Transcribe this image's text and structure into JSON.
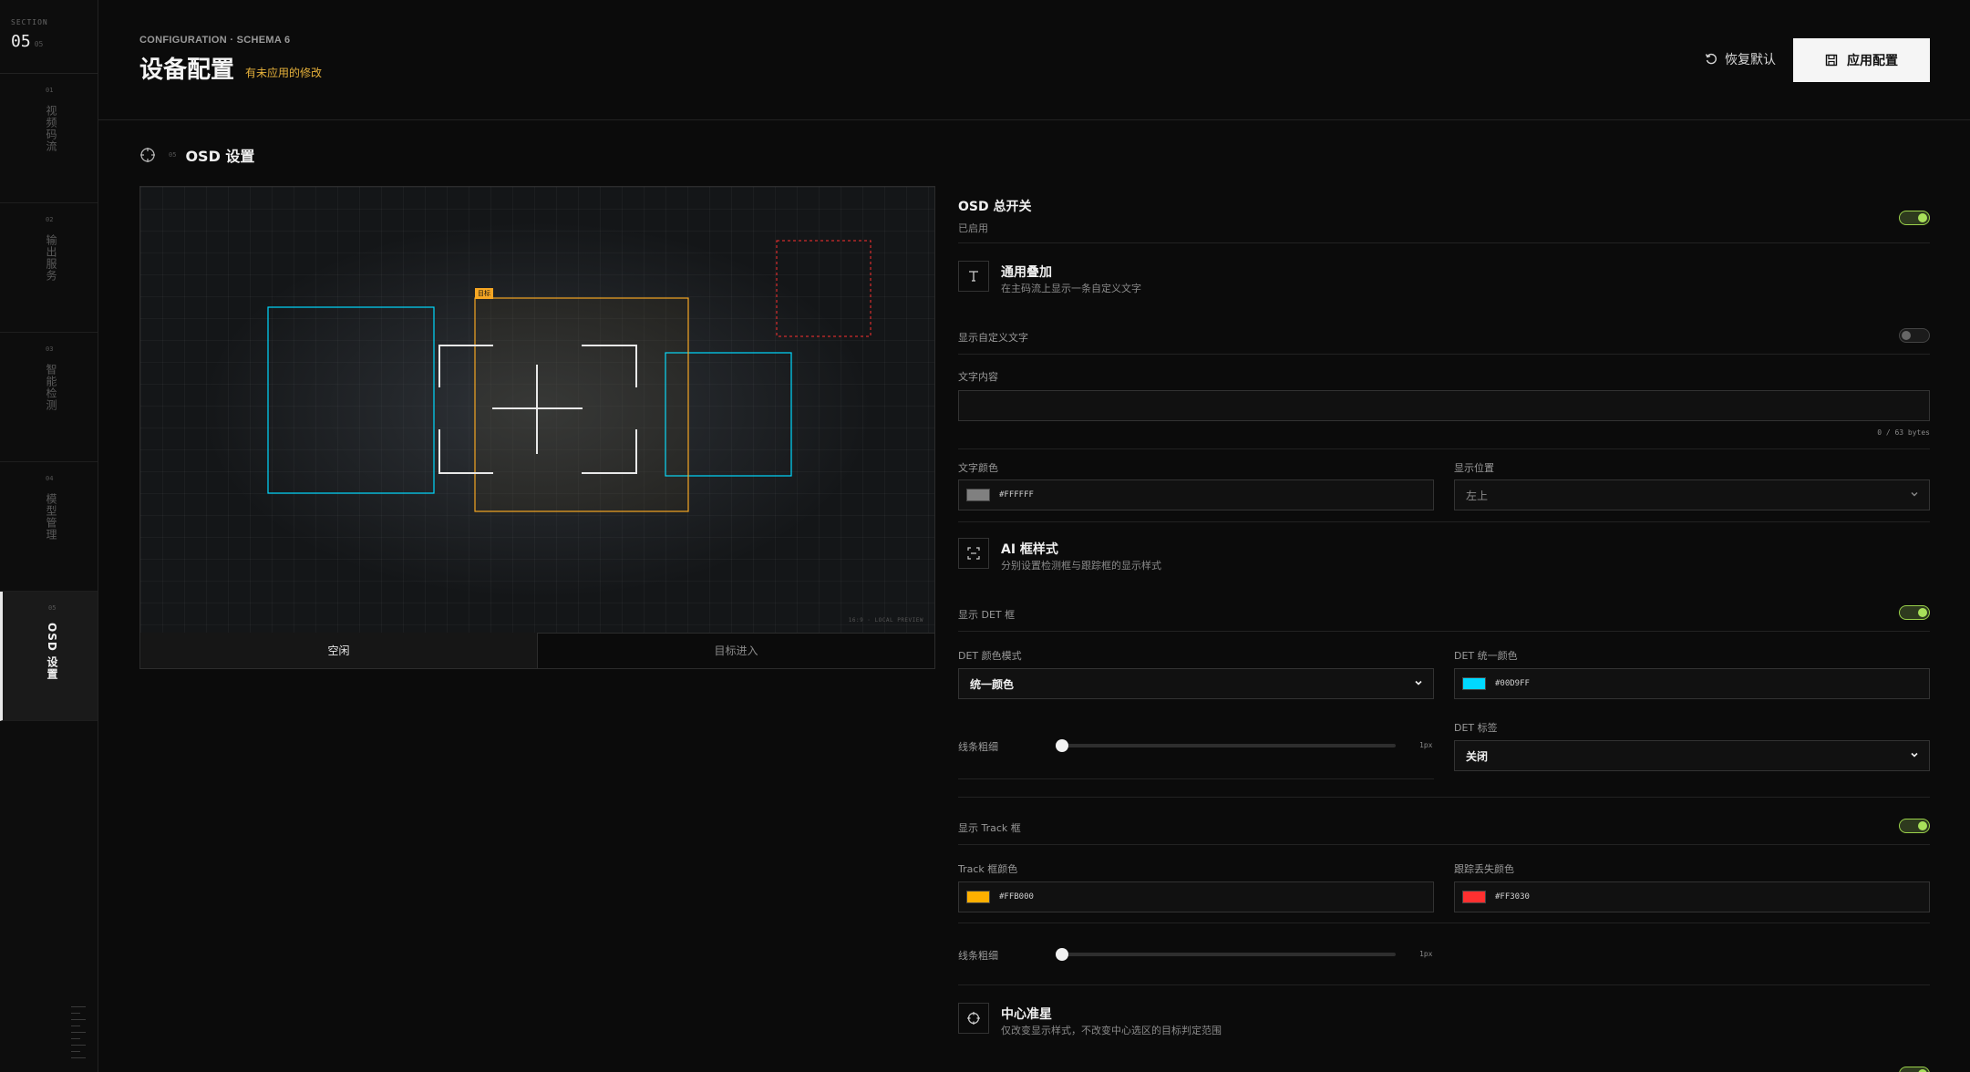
{
  "sidebar": {
    "section_label": "SECTION",
    "section_num": "05",
    "section_total": "05",
    "items": [
      {
        "num": "01",
        "label": "视频码流"
      },
      {
        "num": "02",
        "label": "输出服务"
      },
      {
        "num": "03",
        "label": "智能检测"
      },
      {
        "num": "04",
        "label": "模型管理"
      },
      {
        "num": "05",
        "label": "OSD 设置"
      }
    ]
  },
  "header": {
    "breadcrumb": "CONFIGURATION · SCHEMA 6",
    "title": "设备配置",
    "unsaved": "有未应用的修改",
    "reset_label": "恢复默认",
    "apply_label": "应用配置"
  },
  "section": {
    "index": "05",
    "title": "OSD 设置"
  },
  "preview": {
    "watermark": "16:9 · LOCAL PREVIEW",
    "track_tag": "目标",
    "tabs": [
      "空闲",
      "目标进入"
    ]
  },
  "panel": {
    "osd_master": {
      "title": "OSD 总开关",
      "status": "已启用",
      "enabled": true
    },
    "general": {
      "title": "通用叠加",
      "desc": "在主码流上显示一条自定义文字"
    },
    "show_custom_text": {
      "label": "显示自定义文字",
      "enabled": false
    },
    "text_content": {
      "label": "文字内容",
      "value": "",
      "counter": "0 / 63 bytes"
    },
    "text_color": {
      "label": "文字颜色",
      "value": "#FFFFFF",
      "swatch": "#808080"
    },
    "position": {
      "label": "显示位置",
      "value": "左上"
    },
    "ai_box": {
      "title": "AI 框样式",
      "desc": "分别设置检测框与跟踪框的显示样式"
    },
    "show_det": {
      "label": "显示 DET 框",
      "enabled": true
    },
    "det_color_mode": {
      "label": "DET 颜色模式",
      "value": "统一颜色"
    },
    "det_color": {
      "label": "DET 统一颜色",
      "value": "#00D9FF",
      "swatch": "#00d9ff"
    },
    "det_line": {
      "label": "线条粗细",
      "value": "1px"
    },
    "det_tag": {
      "label": "DET 标签",
      "value": "关闭"
    },
    "show_track": {
      "label": "显示 Track 框",
      "enabled": true
    },
    "track_color": {
      "label": "Track 框颜色",
      "value": "#FFB000",
      "swatch": "#ffb000"
    },
    "lost_color": {
      "label": "跟踪丢失颜色",
      "value": "#FF3030",
      "swatch": "#ff3030"
    },
    "track_line": {
      "label": "线条粗细",
      "value": "1px"
    },
    "crosshair": {
      "title": "中心准星",
      "desc": "仅改变显示样式，不改变中心选区的目标判定范围"
    }
  },
  "colors": {
    "det": "#00d9ff",
    "track": "#f5a623",
    "lost": "#ff3030",
    "toggle_on": "#9ad14a"
  }
}
